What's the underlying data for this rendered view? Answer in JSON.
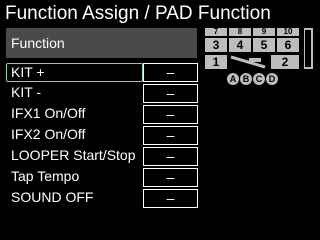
{
  "screen": {
    "title": "Function Assign / PAD Function",
    "column_header": "Function"
  },
  "rows": [
    {
      "label": "KIT +",
      "value": "–",
      "selected": true
    },
    {
      "label": "KIT -",
      "value": "–",
      "selected": false
    },
    {
      "label": "IFX1 On/Off",
      "value": "–",
      "selected": false
    },
    {
      "label": "IFX2 On/Off",
      "value": "–",
      "selected": false
    },
    {
      "label": "LOOPER Start/Stop",
      "value": "–",
      "selected": false
    },
    {
      "label": "Tap Tempo",
      "value": "–",
      "selected": false
    },
    {
      "label": "SOUND OFF",
      "value": "–",
      "selected": false
    }
  ],
  "pad_diagram": {
    "top_row": [
      "7",
      "8",
      "9",
      "10"
    ],
    "middle_row": [
      "3",
      "4",
      "5",
      "6"
    ],
    "bottom_left": "1",
    "bottom_right": "2",
    "circles": [
      "A",
      "B",
      "C",
      "D"
    ]
  },
  "colors": {
    "background": "#000000",
    "header_bar": "#4a4a4a",
    "selection_border": "#7fd1c2",
    "pad_fill": "#bdbdbd"
  }
}
